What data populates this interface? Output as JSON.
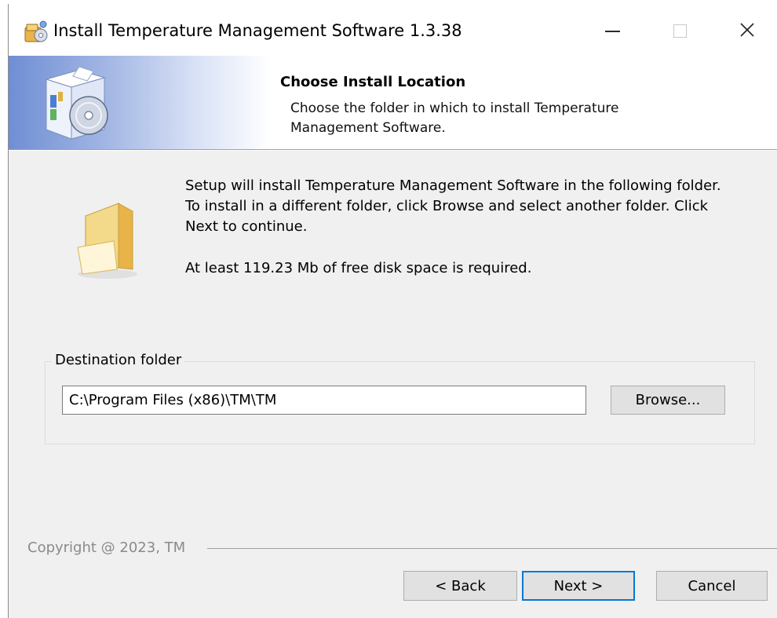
{
  "window": {
    "title": "Install Temperature Management Software 1.3.38",
    "controls": {
      "minimize": "minimize-icon",
      "maximize": "maximize-icon",
      "close": "close-icon"
    },
    "close_glyph": "✕"
  },
  "header": {
    "title": "Choose Install Location",
    "subtitle": "Choose the folder in which to install Temperature Management Software."
  },
  "body": {
    "instructions": "Setup will install Temperature Management Software in the following folder. To install in a different folder, click Browse and select another folder. Click Next to continue.",
    "space_required": "At least 119.23 Mb of free disk space is required."
  },
  "destination": {
    "group_label": "Destination folder",
    "path_value": "C:\\Program Files (x86)\\TM\\TM",
    "browse_label": "Browse..."
  },
  "footer": {
    "copyright": "Copyright @ 2023, TM",
    "back_label": "< Back",
    "next_label": "Next >",
    "cancel_label": "Cancel"
  },
  "colors": {
    "accent": "#0078d7",
    "banner_gradient_start": "#6f8ed3",
    "dialog_bg": "#f0f0f0"
  }
}
